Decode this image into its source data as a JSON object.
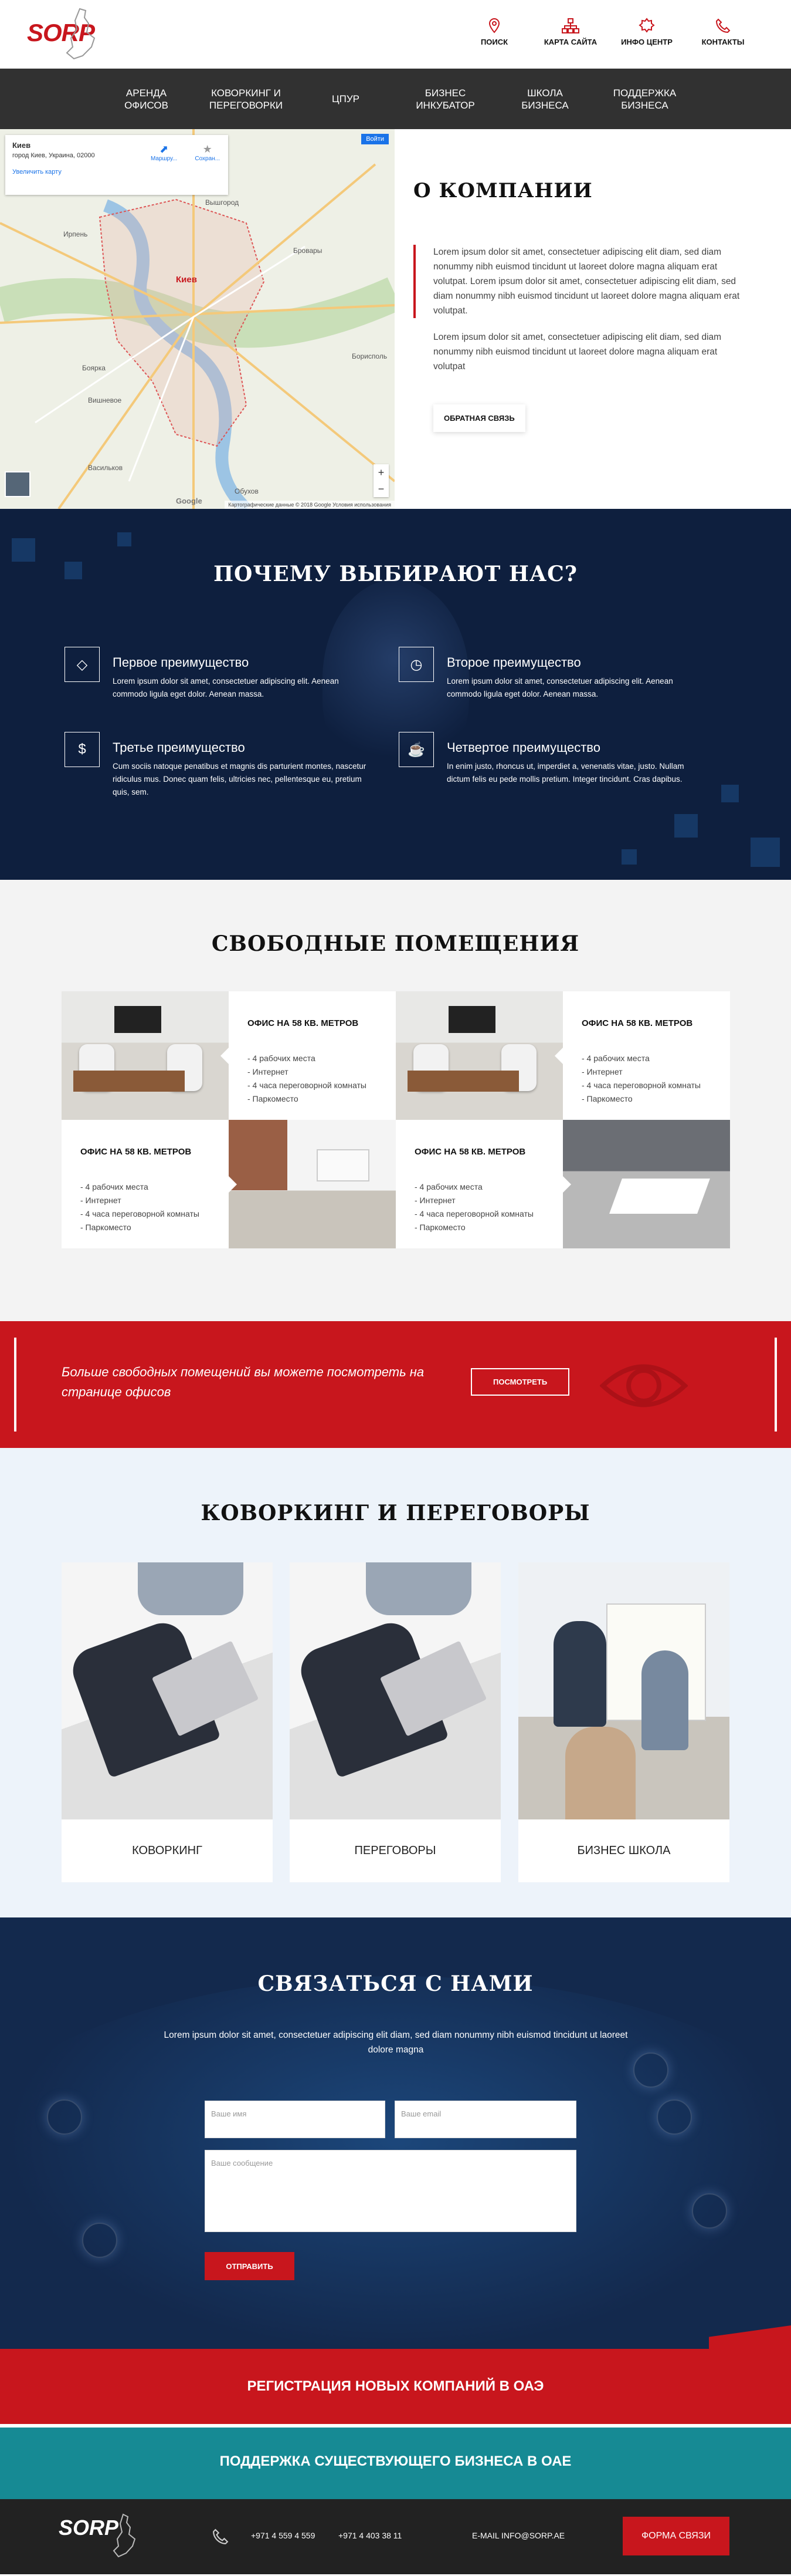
{
  "header": {
    "logo_text": "SORP",
    "nav": [
      {
        "label": "ПОИСК",
        "icon": "location-pin-icon"
      },
      {
        "label": "КАРТА САЙТА",
        "icon": "sitemap-icon"
      },
      {
        "label": "ИНФО ЦЕНТР",
        "icon": "info-badge-icon"
      },
      {
        "label": "КОНТАКТЫ",
        "icon": "phone-icon"
      }
    ]
  },
  "mainnav": [
    "АРЕНДА\nОФИСОВ",
    "КОВОРКИНГ И\nПЕРЕГОВОРКИ",
    "ЦПУР",
    "БИЗНЕС\nИНКУБАТОР",
    "ШКОЛА\nБИЗНЕСА",
    "ПОДДЕРЖКА\nБИЗНЕСА"
  ],
  "map": {
    "place_title": "Киев",
    "place_address": "город Киев, Украина, 02000",
    "enlarge_link": "Увеличить карту",
    "route_label": "Маршру...",
    "save_label": "Сохран...",
    "signin": "Войти",
    "copyright": "Картографические данные © 2018 Google   Условия использования",
    "google": "Google",
    "city_labels": [
      "Ирпень",
      "Вышгород",
      "Бровары",
      "Киев",
      "Боярка",
      "Вишневое",
      "Васильков",
      "Обухов",
      "Борисполь"
    ]
  },
  "about": {
    "title": "О КОМПАНИИ",
    "quote": "Lorem ipsum dolor sit amet, consectetuer adipiscing elit diam, sed diam nonummy nibh euismod tincidunt ut laoreet dolore magna aliquam erat volutpat. Lorem ipsum dolor sit amet, consectetuer adipiscing elit diam, sed diam nonummy nibh euismod tincidunt ut laoreet dolore magna aliquam erat volutpat.",
    "para": "Lorem ipsum dolor sit amet, consectetuer adipiscing elit diam, sed diam nonummy nibh euismod tincidunt ut laoreet dolore magna aliquam erat volutpat",
    "button": "ОБРАТНАЯ СВЯЗЬ"
  },
  "why": {
    "title": "ПОЧЕМУ ВЫБИРАЮТ НАС?",
    "items": [
      {
        "icon": "diamond-icon",
        "title": "Первое преимущество",
        "text": "Lorem ipsum dolor sit amet, consectetuer adipiscing elit. Aenean commodo ligula eget dolor. Aenean massa."
      },
      {
        "icon": "clock-icon",
        "title": "Второе преимущество",
        "text": "Lorem ipsum dolor sit amet, consectetuer adipiscing elit. Aenean commodo ligula eget dolor. Aenean massa."
      },
      {
        "icon": "dollar-icon",
        "title": "Третье преимущество",
        "text": "Cum sociis natoque penatibus et magnis dis parturient montes, nascetur ridiculus mus. Donec quam felis, ultricies nec, pellentesque eu, pretium quis, sem."
      },
      {
        "icon": "coffee-cup-icon",
        "title": "Четвертое преимущество",
        "text": "In enim justo, rhoncus ut, imperdiet a, venenatis vitae, justo. Nullam dictum felis eu pede mollis pretium. Integer tincidunt. Cras dapibus."
      }
    ]
  },
  "free": {
    "title": "СВОБОДНЫЕ ПОМЕЩЕНИЯ",
    "offices": [
      {
        "title": "ОФИС НА 58 КВ. МЕТРОВ",
        "features": [
          "- 4 рабочих места",
          "- Интернет",
          "- 4 часа переговорной комнаты",
          "- Паркоместо"
        ]
      },
      {
        "title": "ОФИС НА 58 КВ. МЕТРОВ",
        "features": [
          "- 4 рабочих места",
          "- Интернет",
          "- 4 часа переговорной комнаты",
          "- Паркоместо"
        ]
      },
      {
        "title": "ОФИС НА 58 КВ. МЕТРОВ",
        "features": [
          "- 4 рабочих места",
          "- Интернет",
          "- 4 часа переговорной комнаты",
          "- Паркоместо"
        ]
      },
      {
        "title": "ОФИС НА 58 КВ. МЕТРОВ",
        "features": [
          "- 4 рабочих места",
          "- Интернет",
          "- 4 часа переговорной комнаты",
          "- Паркоместо"
        ]
      }
    ]
  },
  "banner": {
    "text": "Больше свободных помещений вы можете посмотреть на странице офисов",
    "button": "ПОСМОТРЕТЬ",
    "icon": "eye-icon"
  },
  "cowork": {
    "title": "КОВОРКИНГ И ПЕРЕГОВОРЫ",
    "cards": [
      "КОВОРКИНГ",
      "ПЕРЕГОВОРЫ",
      "БИЗНЕС ШКОЛА"
    ]
  },
  "contact": {
    "title": "СВЯЗАТЬСЯ С НАМИ",
    "lead": "Lorem ipsum dolor sit amet, consectetuer adipiscing elit diam, sed diam nonummy nibh euismod tincidunt ut laoreet dolore magna",
    "name_placeholder": "Ваше имя",
    "email_placeholder": "Ваше email",
    "message_placeholder": "Ваше сообщение",
    "send": "ОТПРАВИТЬ"
  },
  "bands": {
    "red": "РЕГИСТРАЦИЯ НОВЫХ КОМПАНИЙ В ОАЭ",
    "teal": "ПОДДЕРЖКА СУЩЕСТВУЮЩЕГО БИЗНЕСА В ОАЕ"
  },
  "footer": {
    "logo_text": "SORP",
    "phone1": "+971 4 559 4 559",
    "phone2": "+971 4 403 38 11",
    "email": "E-MAIL INFO@SORP.AE",
    "button": "ФОРМА СВЯЗИ",
    "phone_icon": "phone-icon"
  },
  "colors": {
    "accent": "#c8161d",
    "dark": "#313131",
    "navy": "#13294d",
    "teal": "#168a94"
  }
}
